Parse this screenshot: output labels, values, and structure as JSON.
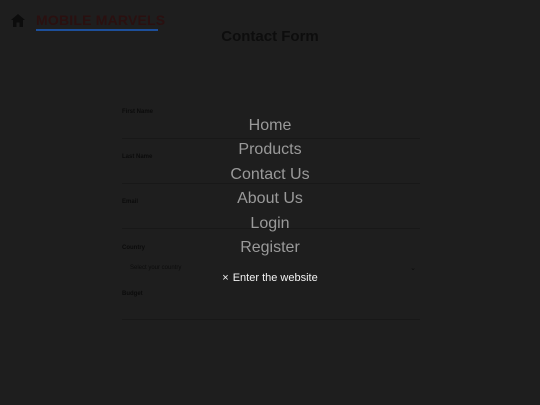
{
  "brand": {
    "name": "MOBILE MARVELS"
  },
  "page": {
    "title": "Contact Form"
  },
  "form": {
    "fields": [
      {
        "label": "First Name",
        "placeholder": ""
      },
      {
        "label": "Last Name",
        "placeholder": ""
      },
      {
        "label": "Email",
        "placeholder": ""
      },
      {
        "label": "Country",
        "value": "Select your country"
      },
      {
        "label": "Budget",
        "placeholder": ""
      }
    ]
  },
  "overlay": {
    "nav_items": [
      "Home",
      "Products",
      "Contact Us",
      "About Us",
      "Login",
      "Register"
    ],
    "close_label": "Enter the website",
    "close_glyph": "×"
  },
  "colors": {
    "background": "#1e1e1e",
    "brand_underline": "#1d4f9a",
    "nav_text": "#9a9a9a",
    "close_text": "#f2f2f2"
  }
}
